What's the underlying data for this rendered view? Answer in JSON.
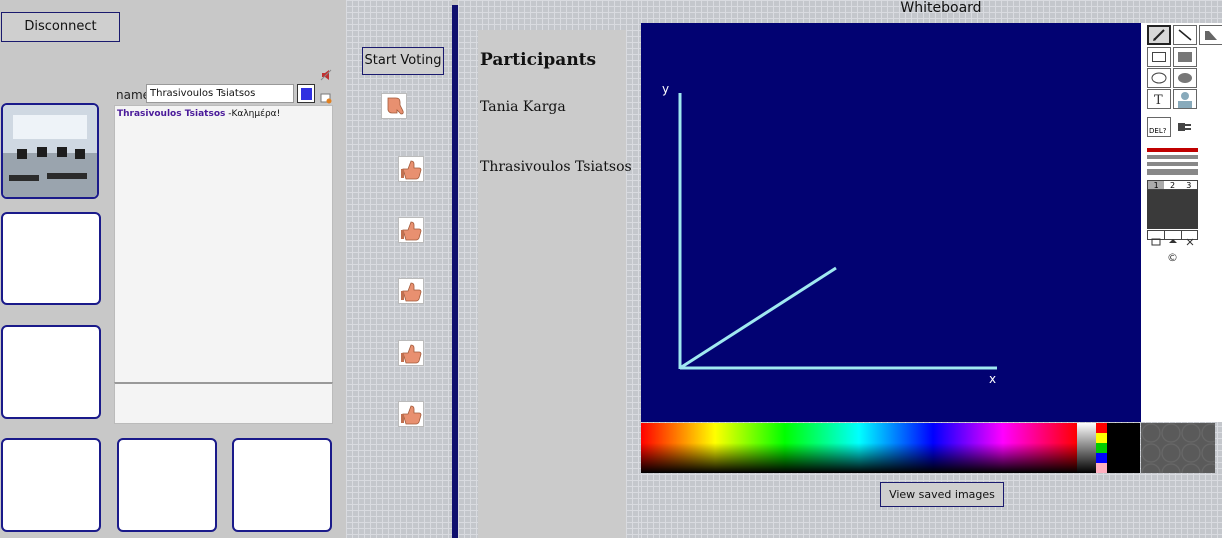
{
  "left": {
    "disconnect_label": "Disconnect",
    "name_label": "name",
    "name_value": "Thrasivoulos Tsiatsos",
    "chat": {
      "sender": "Thrasivoulos Tsiatsos",
      "message": " -Καλημέρα!"
    }
  },
  "voting": {
    "start_label": "Start Voting"
  },
  "participants": {
    "title": "Participants",
    "names": [
      "Tania Karga",
      "Thrasivoulos Tsiatsos"
    ]
  },
  "whiteboard": {
    "title": "Whiteboard",
    "canvas_bg": "#020272",
    "stroke_color": "#a0e8f0",
    "axis_y_label": "y",
    "axis_x_label": "x",
    "del_label": "DEL?",
    "pages": [
      "1",
      "2",
      "3"
    ],
    "copyright": "©",
    "view_saved_label": "View saved images",
    "quick_colors": [
      "#ff0000",
      "#ffff00",
      "#00cc00",
      "#0000ff",
      "#ffb0c0"
    ]
  },
  "icons": [
    "speaker-icon",
    "thumb-down-icon",
    "thumb-up-icon",
    "pencil-icon",
    "line-icon",
    "eraser-icon",
    "rectangle-icon",
    "filled-rectangle-icon",
    "ellipse-icon",
    "filled-ellipse-icon",
    "text-icon",
    "avatar-icon",
    "delete-icon",
    "plug-icon"
  ]
}
